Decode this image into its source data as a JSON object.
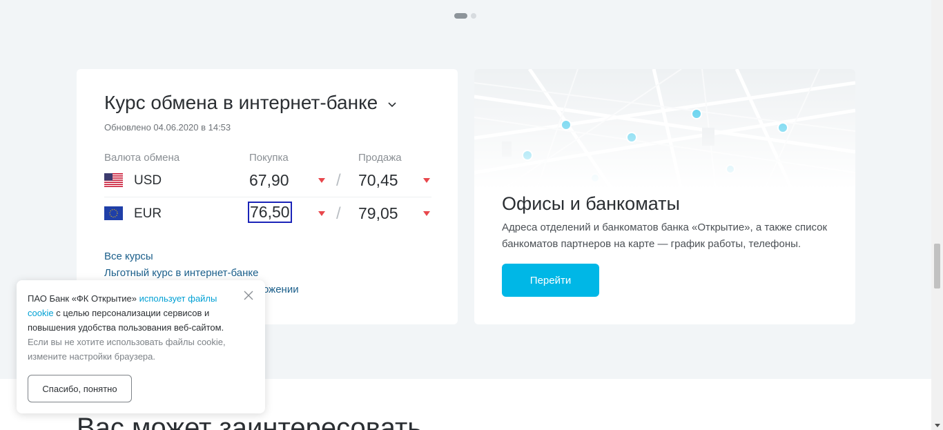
{
  "rates": {
    "title": "Курс обмена в интернет-банке",
    "updated": "Обновлено 04.06.2020 в 14:53",
    "col_currency": "Валюта обмена",
    "col_buy": "Покупка",
    "col_sell": "Продажа",
    "rows": [
      {
        "code": "USD",
        "buy": "67,90",
        "sell": "70,45"
      },
      {
        "code": "EUR",
        "buy": "76,50",
        "sell": "79,05"
      }
    ],
    "links": {
      "all": "Все курсы",
      "preferential": "Льготный курс в интернет-банке",
      "app_suffix": "ожении"
    }
  },
  "offices": {
    "title": "Офисы и банкоматы",
    "description": "Адреса отделений и банкоматов банка «Открытие», а также список банкоматов партнеров на карте — график работы, телефоны.",
    "button": "Перейти"
  },
  "section": {
    "title": "Вас может заинтересовать"
  },
  "cookie": {
    "text_start": "ПАО Банк «ФК Открытие» ",
    "link": "использует файлы cookie",
    "text_mid": " с целью персонализации сервисов и повышения удобства пользования веб-сайтом.",
    "text_muted": "Если вы не хотите использовать файлы cookie, измените настройки браузера.",
    "button": "Спасибо, понятно"
  },
  "colors": {
    "accent": "#00b7e6",
    "down": "#e8474c",
    "link": "#1a5e8a"
  },
  "icons": [
    "chevron-down-icon",
    "us-flag-icon",
    "eu-flag-icon",
    "arrow-down-icon",
    "close-icon",
    "map-pin-icon"
  ]
}
